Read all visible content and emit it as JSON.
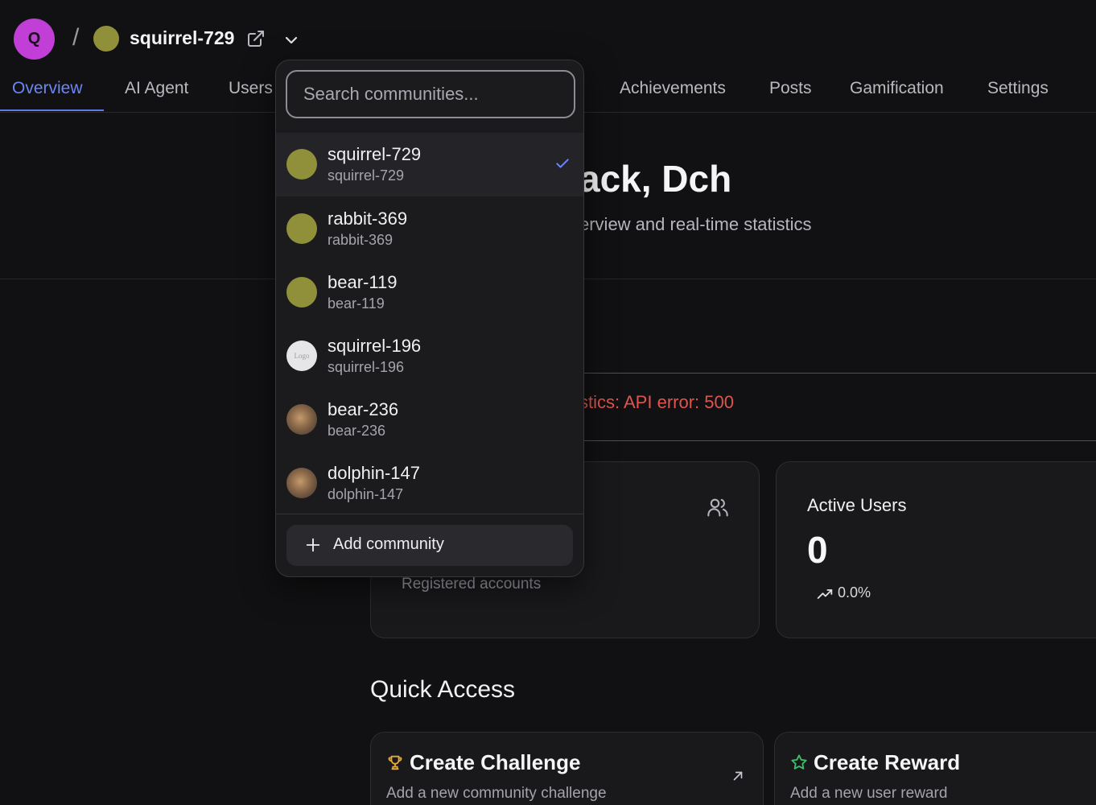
{
  "header": {
    "avatar_letter": "Q",
    "separator": "/",
    "community_name": "squirrel-729"
  },
  "tabs": [
    {
      "label": "Overview",
      "active": true
    },
    {
      "label": "AI Agent"
    },
    {
      "label": "Users"
    },
    {
      "label": "Achievements"
    },
    {
      "label": "Posts"
    },
    {
      "label": "Gamification"
    },
    {
      "label": "Settings"
    }
  ],
  "hero": {
    "title_visible": "ack, Dch",
    "subtitle_visible": "erview and real-time statistics"
  },
  "error": {
    "message_visible": "stics: API error: 500"
  },
  "stats": {
    "users_card_sub": "Registered accounts",
    "active_title": "Active Users",
    "active_value": "0",
    "active_trend": "0.0%"
  },
  "quick_access": {
    "title": "Quick Access",
    "create_challenge": {
      "title": "Create Challenge",
      "subtitle": "Add a new community challenge"
    },
    "create_reward": {
      "title": "Create Reward",
      "subtitle": "Add a new user reward"
    }
  },
  "dropdown": {
    "search_placeholder": "Search communities...",
    "items": [
      {
        "name": "squirrel-729",
        "slug": "squirrel-729",
        "avatar": "olive-dot",
        "selected": true
      },
      {
        "name": "rabbit-369",
        "slug": "rabbit-369",
        "avatar": "olive-dot"
      },
      {
        "name": "bear-119",
        "slug": "bear-119",
        "avatar": "olive-dot"
      },
      {
        "name": "squirrel-196",
        "slug": "squirrel-196",
        "avatar": "logo-placeholder",
        "avatar_text": "Logo"
      },
      {
        "name": "bear-236",
        "slug": "bear-236",
        "avatar": "photo"
      },
      {
        "name": "dolphin-147",
        "slug": "dolphin-147",
        "avatar": "photo"
      }
    ],
    "add_label": "Add community"
  },
  "colors": {
    "accent": "#6b86f5",
    "avatar_bg": "#c13fd6",
    "community_dot": "#908f3a",
    "error": "#e0544d"
  }
}
